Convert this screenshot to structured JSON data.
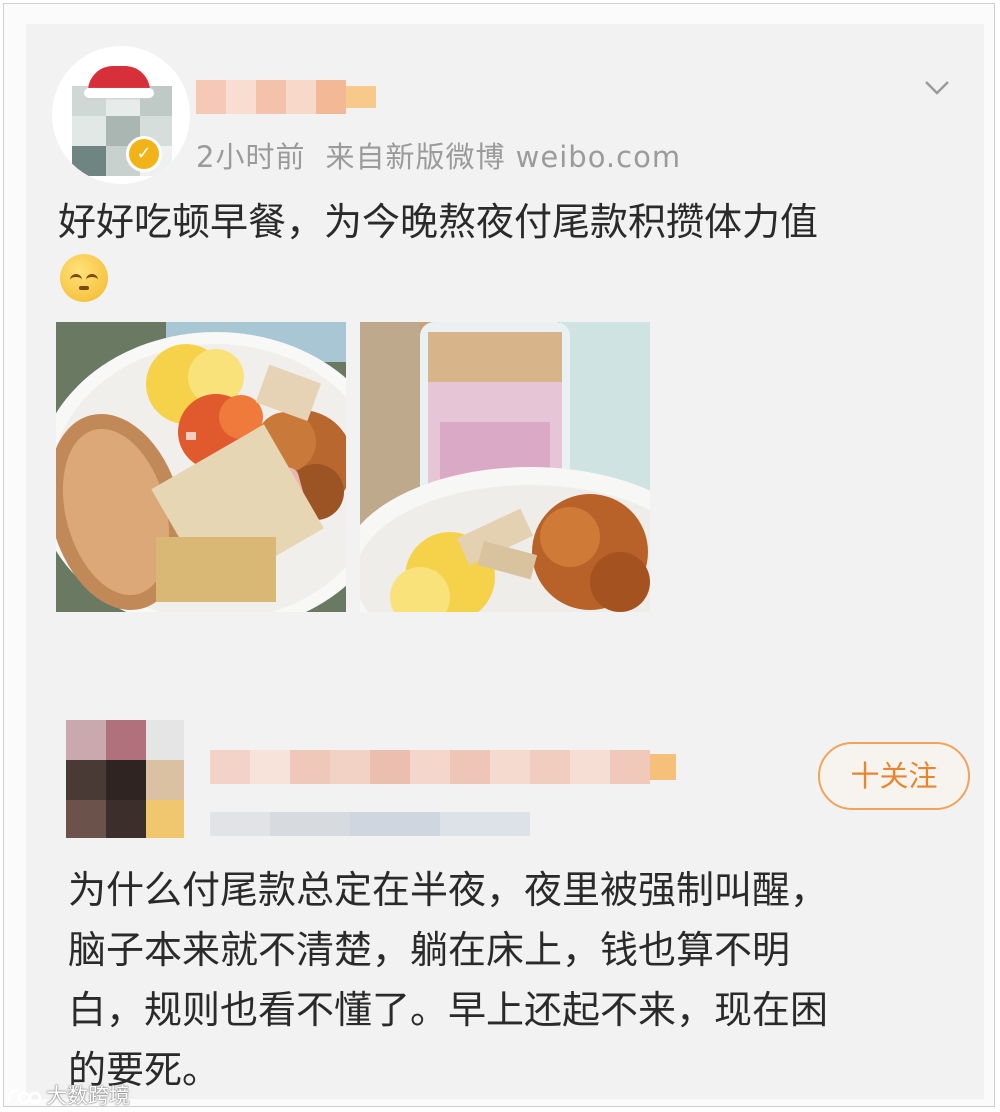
{
  "post": {
    "time": "2小时前",
    "source": "来自新版微博 weibo.com",
    "text": "好好吃顿早餐，为今晚熬夜付尾款积攒体力值",
    "emoji": "dizzy-face-emoji",
    "images": [
      "breakfast-plate-photo",
      "breakfast-yogurt-photo"
    ]
  },
  "comment": {
    "follow_label": "十关注",
    "lines": [
      "为什么付尾款总定在半夜，夜里被强制叫醒，",
      "脑子本来就不清楚，躺在床上，钱也算不明",
      "白，规则也看不懂了。早上还起不来，现在困",
      "的要死。"
    ]
  },
  "watermark": "大数跨境",
  "colors": {
    "card_bg": "#f2f2f2",
    "meta_text": "#9b9b9b",
    "follow_accent": "#e8862f",
    "verify_badge": "#f2b318"
  }
}
